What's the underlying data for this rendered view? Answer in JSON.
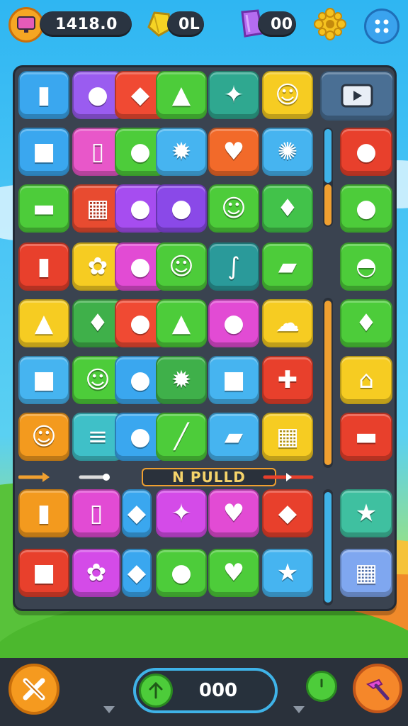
{
  "topbar": {
    "coins_value": "1418.0",
    "gems_value": "0L",
    "crystals_value": "00",
    "icons": [
      "monitor-icon",
      "gem-icon",
      "crystal-icon",
      "gear-icon",
      "menu-dots-icon"
    ]
  },
  "board": {
    "side_header_icon": "play-icon",
    "divider_label": "N PULLD",
    "colors": {
      "board_bg": "#3a4350",
      "accent_orange": "#f0a030",
      "accent_blue": "#3fb3e8"
    }
  },
  "tiles_top": [
    [
      {
        "icon": "battery-icon",
        "glyph": "▮",
        "color": "#3aa7ef"
      },
      {
        "icon": "blob-icon",
        "glyph": "●",
        "color": "#9a5cf0"
      },
      {
        "icon": "ship-icon",
        "glyph": "◆",
        "color": "#f04a33"
      },
      {
        "icon": "rocket-icon",
        "glyph": "▲",
        "color": "#4dcc3a"
      },
      {
        "icon": "pickaxe-icon",
        "glyph": "✦",
        "color": "#2fa890"
      },
      {
        "icon": "smiley-icon",
        "glyph": "☺",
        "color": "#f6cc22"
      }
    ],
    [
      {
        "icon": "puzzle-icon",
        "glyph": "■",
        "color": "#3aa7ef"
      },
      {
        "icon": "phone-icon",
        "glyph": "▯",
        "color": "#e857c9"
      },
      {
        "icon": "lemon-icon",
        "glyph": "●",
        "color": "#4dcc3a"
      },
      {
        "icon": "sun-icon",
        "glyph": "✹",
        "color": "#46b4f0"
      },
      {
        "icon": "heart-icon",
        "glyph": "♥",
        "color": "#f26a2a"
      },
      {
        "icon": "sunflower-icon",
        "glyph": "✺",
        "color": "#46b4f0"
      }
    ],
    [
      {
        "icon": "car-icon",
        "glyph": "▬",
        "color": "#4dcc3a"
      },
      {
        "icon": "calculator-icon",
        "glyph": "▦",
        "color": "#e84b30"
      },
      {
        "icon": "balloon-icon",
        "glyph": "●",
        "color": "#a64df0"
      },
      {
        "icon": "bomb-icon",
        "glyph": "●",
        "color": "#8a49e8"
      },
      {
        "icon": "smiley-icon",
        "glyph": "☺",
        "color": "#4dcc3a"
      },
      {
        "icon": "strawberry-icon",
        "glyph": "♦",
        "color": "#42c24a"
      }
    ],
    [
      {
        "icon": "battery-icon",
        "glyph": "▮",
        "color": "#e8402c"
      },
      {
        "icon": "flower-icon",
        "glyph": "✿",
        "color": "#f6cc22"
      },
      {
        "icon": "egg-icon",
        "glyph": "●",
        "color": "#e24bd4"
      },
      {
        "icon": "smiley-icon",
        "glyph": "☺",
        "color": "#4dcc3a"
      },
      {
        "icon": "hook-icon",
        "glyph": "∫",
        "color": "#2a9a9a"
      },
      {
        "icon": "pencil-icon",
        "glyph": "▰",
        "color": "#4dcc3a"
      }
    ],
    [
      {
        "icon": "drop-icon",
        "glyph": "▲",
        "color": "#f6cc22"
      },
      {
        "icon": "ruby-icon",
        "glyph": "♦",
        "color": "#3fb04a"
      },
      {
        "icon": "leaf-icon",
        "glyph": "●",
        "color": "#f04a33"
      },
      {
        "icon": "flask-icon",
        "glyph": "▲",
        "color": "#4dcc3a"
      },
      {
        "icon": "radish-icon",
        "glyph": "●",
        "color": "#e24bd4"
      },
      {
        "icon": "cloud-icon",
        "glyph": "☁",
        "color": "#f6cc22"
      }
    ],
    [
      {
        "icon": "bag-icon",
        "glyph": "■",
        "color": "#46b4f0"
      },
      {
        "icon": "smiley-icon",
        "glyph": "☺",
        "color": "#4dcc3a"
      },
      {
        "icon": "lollipop-icon",
        "glyph": "●",
        "color": "#3aa7ef"
      },
      {
        "icon": "sun-icon",
        "glyph": "✹",
        "color": "#3fb04a"
      },
      {
        "icon": "chip-icon",
        "glyph": "■",
        "color": "#46b4f0"
      },
      {
        "icon": "tool-icon",
        "glyph": "✚",
        "color": "#e8402c"
      }
    ],
    [
      {
        "icon": "smiley-icon",
        "glyph": "☺",
        "color": "#f39a1e"
      },
      {
        "icon": "books-icon",
        "glyph": "≡",
        "color": "#3fc0c8"
      },
      {
        "icon": "chili-icon",
        "glyph": "●",
        "color": "#3aa7ef"
      },
      {
        "icon": "brush-icon",
        "glyph": "╱",
        "color": "#4dcc3a"
      },
      {
        "icon": "eraser-icon",
        "glyph": "▰",
        "color": "#46b4f0"
      },
      {
        "icon": "window-icon",
        "glyph": "▦",
        "color": "#f6cc22"
      }
    ]
  ],
  "tiles_side": [
    {
      "icon": "ghost-icon",
      "glyph": "●",
      "color": "#e8402c"
    },
    {
      "icon": "leaf-icon",
      "glyph": "●",
      "color": "#4dcc3a"
    },
    {
      "icon": "bowl-icon",
      "glyph": "◓",
      "color": "#4dcc3a"
    },
    {
      "icon": "carrot-icon",
      "glyph": "♦",
      "color": "#4dcc3a"
    },
    {
      "icon": "house-icon",
      "glyph": "⌂",
      "color": "#f6cc22"
    },
    {
      "icon": "car-icon",
      "glyph": "▬",
      "color": "#e8402c"
    }
  ],
  "tiles_bottom": [
    [
      {
        "icon": "bottle-icon",
        "glyph": "▮",
        "color": "#f39a1e"
      },
      {
        "icon": "phone-icon",
        "glyph": "▯",
        "color": "#e24bd4"
      },
      {
        "icon": "gem-icon",
        "glyph": "◆",
        "color": "#3aa7ef"
      },
      {
        "icon": "wand-icon",
        "glyph": "✦",
        "color": "#d44be8"
      },
      {
        "icon": "heart-icon",
        "glyph": "♥",
        "color": "#e24bd4"
      },
      {
        "icon": "candy-icon",
        "glyph": "◆",
        "color": "#e8402c"
      }
    ],
    [
      {
        "icon": "jar-icon",
        "glyph": "■",
        "color": "#e8402c"
      },
      {
        "icon": "gear-icon",
        "glyph": "✿",
        "color": "#d44be8"
      },
      {
        "icon": "crystal-icon",
        "glyph": "◆",
        "color": "#3aa7ef"
      },
      {
        "icon": "magnifier-icon",
        "glyph": "●",
        "color": "#4dcc3a"
      },
      {
        "icon": "heart-icon",
        "glyph": "♥",
        "color": "#4dcc3a"
      },
      {
        "icon": "star-icon",
        "glyph": "★",
        "color": "#46b4f0"
      }
    ]
  ],
  "tiles_bottom_side": [
    {
      "icon": "star-icon",
      "glyph": "★",
      "color": "#3fc0a0"
    },
    {
      "icon": "folder-icon",
      "glyph": "▦",
      "color": "#7fa7f0"
    }
  ],
  "bottombar": {
    "counter_value": "000",
    "left_button_icon": "tools-icon",
    "right_button_icon": "hammer-icon",
    "power_icon": "power-icon",
    "arrow_icon": "arrow-up-icon"
  }
}
